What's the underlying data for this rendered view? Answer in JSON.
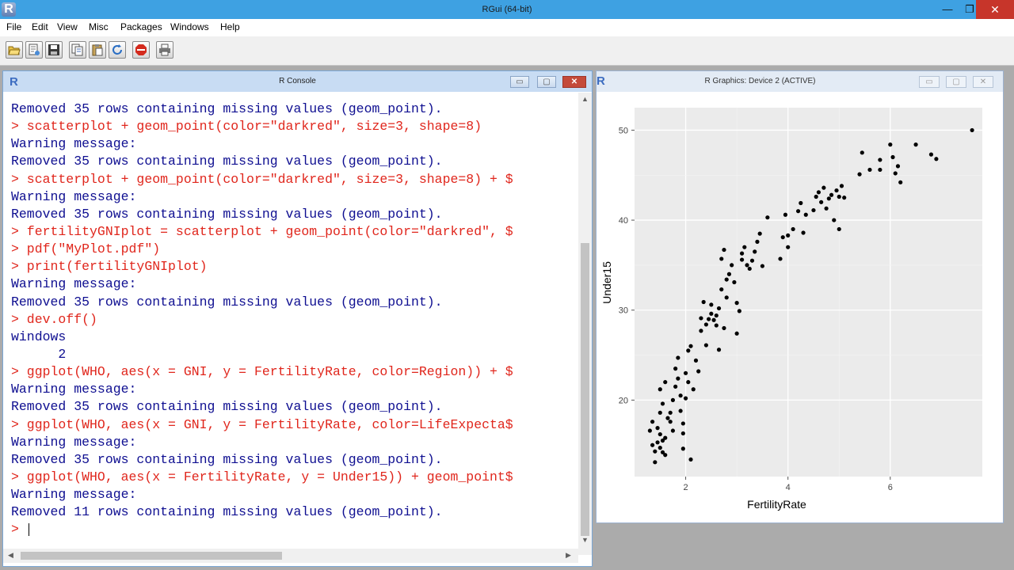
{
  "app": {
    "logo": "R",
    "title": "RGui (64-bit)",
    "controls": {
      "minimize": "—",
      "restore": "❐",
      "close": "✕"
    }
  },
  "menu": [
    "File",
    "Edit",
    "View",
    "Misc",
    "Packages",
    "Windows",
    "Help"
  ],
  "toolbar": {
    "buttons": [
      "open-script-icon",
      "load-workspace-icon",
      "save-icon",
      "copy-icon",
      "paste-icon",
      "refresh-icon",
      "stop-icon",
      "print-icon"
    ]
  },
  "console": {
    "logo": "R",
    "title": "R Console",
    "lines": [
      {
        "type": "out",
        "text": "Removed 35 rows containing missing values (geom_point)."
      },
      {
        "type": "cmd",
        "text": "> scatterplot + geom_point(color=\"darkred\", size=3, shape=8)"
      },
      {
        "type": "out",
        "text": "Warning message:"
      },
      {
        "type": "out",
        "text": "Removed 35 rows containing missing values (geom_point)."
      },
      {
        "type": "cmd",
        "text": "> scatterplot + geom_point(color=\"darkred\", size=3, shape=8) + $"
      },
      {
        "type": "out",
        "text": "Warning message:"
      },
      {
        "type": "out",
        "text": "Removed 35 rows containing missing values (geom_point)."
      },
      {
        "type": "cmd",
        "text": "> fertilityGNIplot = scatterplot + geom_point(color=\"darkred\", $"
      },
      {
        "type": "cmd",
        "text": "> pdf(\"MyPlot.pdf\")"
      },
      {
        "type": "cmd",
        "text": "> print(fertilityGNIplot)"
      },
      {
        "type": "out",
        "text": "Warning message:"
      },
      {
        "type": "out",
        "text": "Removed 35 rows containing missing values (geom_point)."
      },
      {
        "type": "cmd",
        "text": "> dev.off()"
      },
      {
        "type": "out",
        "text": "windows"
      },
      {
        "type": "out",
        "text": "      2"
      },
      {
        "type": "cmd",
        "text": "> ggplot(WHO, aes(x = GNI, y = FertilityRate, color=Region)) + $"
      },
      {
        "type": "out",
        "text": "Warning message:"
      },
      {
        "type": "out",
        "text": "Removed 35 rows containing missing values (geom_point)."
      },
      {
        "type": "cmd",
        "text": "> ggplot(WHO, aes(x = GNI, y = FertilityRate, color=LifeExpecta$"
      },
      {
        "type": "out",
        "text": "Warning message:"
      },
      {
        "type": "out",
        "text": "Removed 35 rows containing missing values (geom_point)."
      },
      {
        "type": "cmd",
        "text": "> ggplot(WHO, aes(x = FertilityRate, y = Under15)) + geom_point$"
      },
      {
        "type": "out",
        "text": "Warning message:"
      },
      {
        "type": "out",
        "text": "Removed 11 rows containing missing values (geom_point)."
      }
    ],
    "prompt": "> "
  },
  "graphics": {
    "logo": "R",
    "title": "R Graphics: Device 2 (ACTIVE)"
  },
  "chart_data": {
    "type": "scatter",
    "title": "",
    "xlabel": "FertilityRate",
    "ylabel": "Under15",
    "xlim": [
      1.0,
      7.8
    ],
    "ylim": [
      11.5,
      52.5
    ],
    "xticks": [
      2,
      4,
      6
    ],
    "yticks": [
      20,
      30,
      40,
      50
    ],
    "grid": true,
    "background": "#ebebeb",
    "point_color": "#000000",
    "points": [
      [
        1.3,
        16.6
      ],
      [
        1.35,
        15.0
      ],
      [
        1.4,
        14.3
      ],
      [
        1.4,
        13.1
      ],
      [
        1.45,
        15.3
      ],
      [
        1.5,
        14.7
      ],
      [
        1.5,
        16.2
      ],
      [
        1.55,
        15.5
      ],
      [
        1.55,
        14.2
      ],
      [
        1.6,
        13.9
      ],
      [
        1.6,
        15.8
      ],
      [
        1.45,
        16.9
      ],
      [
        1.35,
        17.6
      ],
      [
        1.5,
        18.6
      ],
      [
        1.55,
        19.6
      ],
      [
        1.5,
        21.2
      ],
      [
        1.6,
        22.0
      ],
      [
        1.65,
        18.0
      ],
      [
        1.7,
        18.6
      ],
      [
        1.7,
        17.6
      ],
      [
        1.75,
        16.6
      ],
      [
        1.75,
        20.0
      ],
      [
        1.8,
        21.5
      ],
      [
        1.8,
        23.5
      ],
      [
        1.85,
        24.7
      ],
      [
        1.85,
        22.4
      ],
      [
        1.9,
        20.5
      ],
      [
        1.9,
        18.8
      ],
      [
        1.95,
        17.4
      ],
      [
        1.95,
        16.3
      ],
      [
        1.95,
        14.6
      ],
      [
        2.0,
        20.2
      ],
      [
        2.0,
        23.0
      ],
      [
        2.05,
        25.5
      ],
      [
        2.05,
        22.0
      ],
      [
        2.1,
        26.0
      ],
      [
        2.1,
        13.4
      ],
      [
        2.15,
        21.2
      ],
      [
        2.2,
        24.4
      ],
      [
        2.25,
        23.2
      ],
      [
        2.3,
        27.7
      ],
      [
        2.3,
        29.1
      ],
      [
        2.35,
        30.9
      ],
      [
        2.4,
        28.4
      ],
      [
        2.4,
        26.1
      ],
      [
        2.45,
        29.0
      ],
      [
        2.5,
        29.6
      ],
      [
        2.5,
        30.6
      ],
      [
        2.55,
        28.9
      ],
      [
        2.6,
        29.4
      ],
      [
        2.6,
        28.3
      ],
      [
        2.65,
        30.2
      ],
      [
        2.65,
        25.6
      ],
      [
        2.7,
        32.3
      ],
      [
        2.7,
        35.7
      ],
      [
        2.75,
        36.7
      ],
      [
        2.75,
        28.0
      ],
      [
        2.8,
        31.4
      ],
      [
        2.8,
        33.4
      ],
      [
        2.85,
        34.0
      ],
      [
        2.9,
        35.0
      ],
      [
        2.95,
        33.1
      ],
      [
        3.0,
        30.8
      ],
      [
        3.0,
        27.4
      ],
      [
        3.05,
        29.9
      ],
      [
        3.1,
        35.6
      ],
      [
        3.1,
        36.3
      ],
      [
        3.15,
        37.0
      ],
      [
        3.2,
        35.0
      ],
      [
        3.25,
        34.6
      ],
      [
        3.3,
        35.5
      ],
      [
        3.35,
        36.5
      ],
      [
        3.4,
        37.6
      ],
      [
        3.45,
        38.5
      ],
      [
        3.5,
        34.9
      ],
      [
        3.6,
        40.3
      ],
      [
        3.85,
        35.7
      ],
      [
        3.9,
        38.1
      ],
      [
        3.95,
        40.6
      ],
      [
        4.0,
        38.3
      ],
      [
        4.0,
        37.0
      ],
      [
        4.1,
        39.0
      ],
      [
        4.2,
        41.0
      ],
      [
        4.25,
        41.9
      ],
      [
        4.3,
        38.6
      ],
      [
        4.35,
        40.6
      ],
      [
        4.5,
        41.1
      ],
      [
        4.55,
        42.6
      ],
      [
        4.6,
        43.1
      ],
      [
        4.65,
        42.0
      ],
      [
        4.7,
        43.6
      ],
      [
        4.75,
        41.3
      ],
      [
        4.8,
        42.4
      ],
      [
        4.85,
        42.8
      ],
      [
        4.9,
        40.0
      ],
      [
        4.95,
        43.3
      ],
      [
        5.0,
        42.6
      ],
      [
        5.0,
        39.0
      ],
      [
        5.05,
        43.8
      ],
      [
        5.1,
        42.5
      ],
      [
        5.4,
        45.1
      ],
      [
        5.45,
        47.5
      ],
      [
        5.6,
        45.6
      ],
      [
        5.8,
        46.7
      ],
      [
        5.8,
        45.6
      ],
      [
        6.0,
        48.4
      ],
      [
        6.05,
        47.0
      ],
      [
        6.1,
        45.2
      ],
      [
        6.15,
        46.0
      ],
      [
        6.2,
        44.2
      ],
      [
        6.5,
        48.4
      ],
      [
        6.8,
        47.3
      ],
      [
        6.9,
        46.8
      ],
      [
        7.6,
        50.0
      ]
    ]
  }
}
